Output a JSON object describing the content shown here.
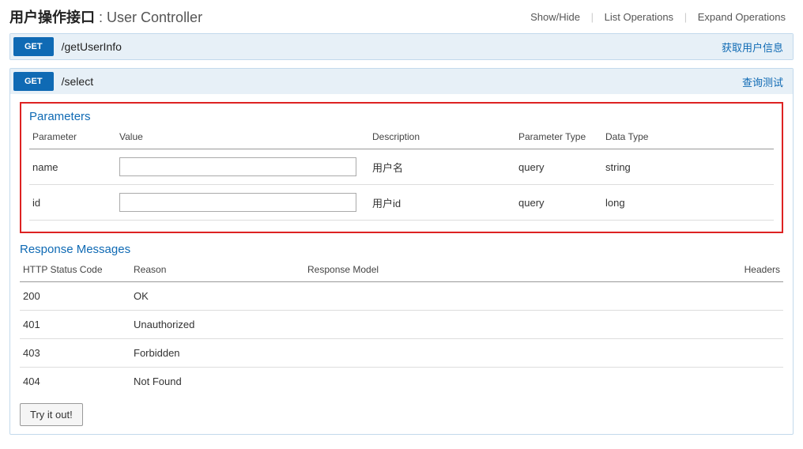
{
  "controller": {
    "name_cn": "用户操作接口",
    "name_en": "User Controller"
  },
  "header_links": {
    "show_hide": "Show/Hide",
    "list_ops": "List Operations",
    "expand_ops": "Expand Operations"
  },
  "operations": [
    {
      "method": "GET",
      "path": "/getUserInfo",
      "summary": "获取用户信息"
    },
    {
      "method": "GET",
      "path": "/select",
      "summary": "查询测试"
    }
  ],
  "parameters_section": {
    "title": "Parameters",
    "headers": {
      "parameter": "Parameter",
      "value": "Value",
      "description": "Description",
      "param_type": "Parameter Type",
      "data_type": "Data Type"
    },
    "rows": [
      {
        "name": "name",
        "value": "",
        "description": "用户名",
        "param_type": "query",
        "data_type": "string"
      },
      {
        "name": "id",
        "value": "",
        "description": "用户id",
        "param_type": "query",
        "data_type": "long"
      }
    ]
  },
  "responses_section": {
    "title": "Response Messages",
    "headers": {
      "code": "HTTP Status Code",
      "reason": "Reason",
      "model": "Response Model",
      "headers": "Headers"
    },
    "rows": [
      {
        "code": "200",
        "reason": "OK"
      },
      {
        "code": "401",
        "reason": "Unauthorized"
      },
      {
        "code": "403",
        "reason": "Forbidden"
      },
      {
        "code": "404",
        "reason": "Not Found"
      }
    ]
  },
  "try_button": "Try it out!"
}
